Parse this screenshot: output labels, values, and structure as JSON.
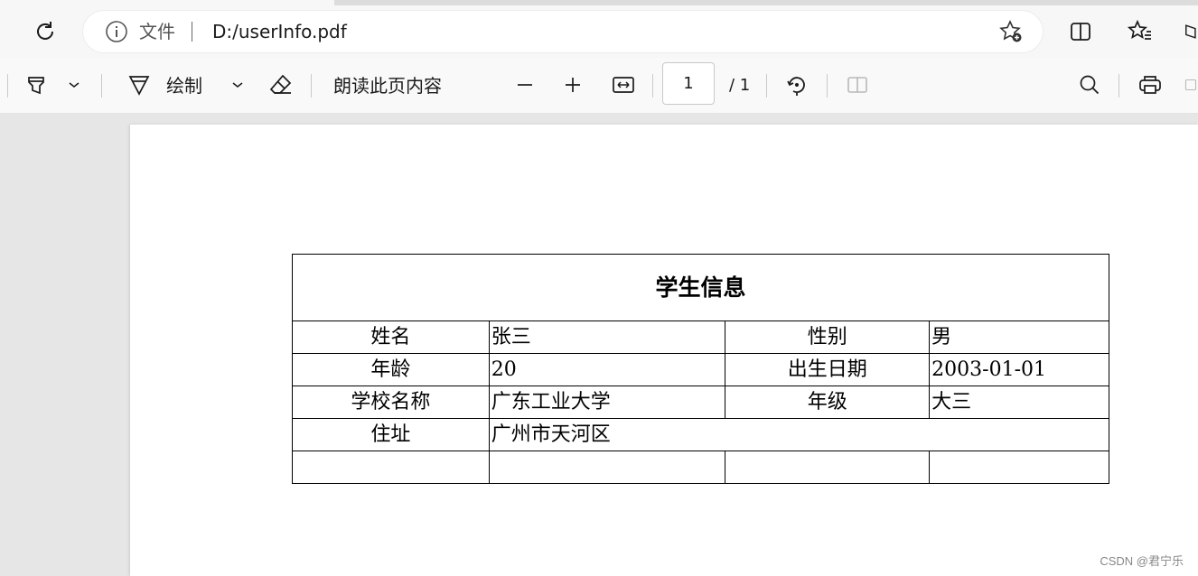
{
  "browser": {
    "address_label": "文件",
    "url": "D:/userInfo.pdf"
  },
  "toolbar": {
    "draw_label": "绘制",
    "read_aloud_label": "朗读此页内容",
    "page_current": "1",
    "page_total": "/ 1"
  },
  "document": {
    "table_title": "学生信息",
    "rows": [
      [
        "姓名",
        "张三",
        "性别",
        "男"
      ],
      [
        "年龄",
        "20",
        "出生日期",
        "2003-01-01"
      ],
      [
        "学校名称",
        "广东工业大学",
        "年级",
        "大三"
      ]
    ],
    "address_label": "住址",
    "address_value": "广州市天河区"
  },
  "watermark": "CSDN @君宁乐",
  "icons": [
    "refresh-icon",
    "info-icon",
    "favorite-add-icon",
    "split-screen-icon",
    "favorites-icon",
    "collections-icon",
    "highlight-icon",
    "chevron-down-icon",
    "draw-icon",
    "eraser-icon",
    "zoom-out-icon",
    "zoom-in-icon",
    "fit-width-icon",
    "rotate-icon",
    "two-page-icon",
    "search-icon",
    "print-icon",
    "save-icon"
  ]
}
